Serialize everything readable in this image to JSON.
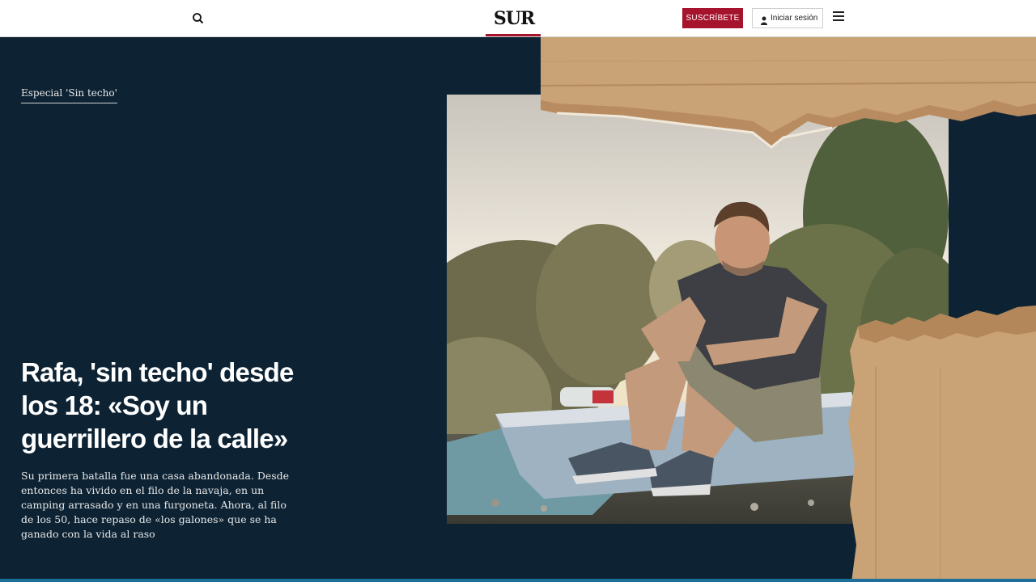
{
  "header": {
    "logo": "SUR",
    "subscribe_label": "SUSCRÍBETE",
    "login_label": "Iniciar sesión",
    "icons": [
      "search-icon",
      "user-icon",
      "hamburger-menu-icon"
    ]
  },
  "article": {
    "kicker": "Especial 'Sin techo'",
    "headline": "Rafa, 'sin techo' desde los 18: «Soy un guerrillero de la calle»",
    "deck": "Su primera batalla fue una casa abandonada. Desde entonces ha vivido en el filo de la navaja, en un camping arrasado y en una furgoneta. Ahora, al filo de los 50, hace repaso de «los galones» que se ha ganado con la vida al raso"
  },
  "colors": {
    "background": "#0d2334",
    "brand_red": "#a5142c",
    "cardboard": "#c9a275"
  }
}
